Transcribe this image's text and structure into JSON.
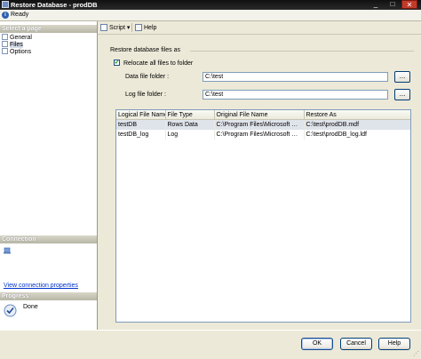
{
  "window": {
    "title": "Restore Database - prodDB",
    "status": "Ready"
  },
  "left_pane": {
    "select_page_header": "Select a page",
    "pages": [
      {
        "label": "General",
        "selected": false
      },
      {
        "label": "Files",
        "selected": true
      },
      {
        "label": "Options",
        "selected": false
      }
    ],
    "connection_header": "Connection",
    "view_connection_link": "View connection properties",
    "progress_header": "Progress",
    "progress_status": "Done"
  },
  "toolbar": {
    "script_label": "Script",
    "help_label": "Help"
  },
  "restore_section": {
    "label": "Restore database files as",
    "relocate_label": "Relocate all files to folder",
    "relocate_checked": true,
    "data_folder_label": "Data file folder :",
    "data_folder_value": "C:\\test",
    "log_folder_label": "Log file folder :",
    "log_folder_value": "C:\\test",
    "browse_label": "..."
  },
  "files_grid": {
    "columns": [
      "Logical File Name",
      "File Type",
      "Original File Name",
      "Restore As"
    ],
    "rows": [
      [
        "testDB",
        "Rows Data",
        "C:\\Program Files\\Microsoft SQL ...",
        "C:\\test\\prodDB.mdf"
      ],
      [
        "testDB_log",
        "Log",
        "C:\\Program Files\\Microsoft SQL ...",
        "C:\\test\\prodDB_log.ldf"
      ]
    ]
  },
  "buttons": {
    "ok": "OK",
    "cancel": "Cancel",
    "help": "Help"
  },
  "colors": {
    "accent": "#2d5fb0",
    "title_bar": "#1a1a1a",
    "panel": "#ece9d8"
  }
}
